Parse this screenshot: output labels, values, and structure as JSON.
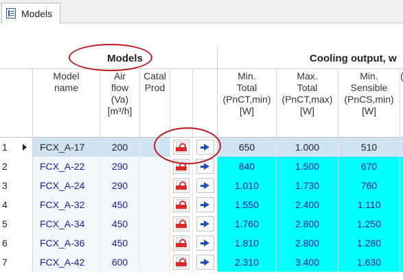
{
  "tab": {
    "title": "Models",
    "icon": "list-window-icon"
  },
  "groups": {
    "models": "Models",
    "cooling": "Cooling output, w"
  },
  "columns": [
    {
      "key": "model_name",
      "label": "Model\nname"
    },
    {
      "key": "air_flow",
      "label": "Air\nflow\n(Va)\n[m³/h]"
    },
    {
      "key": "catal_prod",
      "label": "Catal\nProd"
    },
    {
      "key": "pdf",
      "label": ""
    },
    {
      "key": "go",
      "label": ""
    },
    {
      "key": "min_total",
      "label": "Min.\nTotal\n(PnCT,min)\n[W]"
    },
    {
      "key": "max_total",
      "label": "Max.\nTotal\n(PnCT,max)\n[W]"
    },
    {
      "key": "min_sensible",
      "label": "Min.\nSensible\n(PnCS,min)\n[W]"
    },
    {
      "key": "more",
      "label": "("
    }
  ],
  "rows": [
    {
      "idx": "1",
      "name": "FCX_A-17",
      "air": "200",
      "v1": "650",
      "v2": "1.000",
      "v3": "510",
      "selected": true
    },
    {
      "idx": "2",
      "name": "FCX_A-22",
      "air": "290",
      "v1": "840",
      "v2": "1.500",
      "v3": "670"
    },
    {
      "idx": "3",
      "name": "FCX_A-24",
      "air": "290",
      "v1": "1.010",
      "v2": "1.730",
      "v3": "760"
    },
    {
      "idx": "4",
      "name": "FCX_A-32",
      "air": "450",
      "v1": "1.550",
      "v2": "2.400",
      "v3": "1.110"
    },
    {
      "idx": "5",
      "name": "FCX_A-34",
      "air": "450",
      "v1": "1.760",
      "v2": "2.800",
      "v3": "1.250"
    },
    {
      "idx": "6",
      "name": "FCX_A-36",
      "air": "450",
      "v1": "1.810",
      "v2": "2.800",
      "v3": "1.280"
    },
    {
      "idx": "7",
      "name": "FCX_A-42",
      "air": "600",
      "v1": "2.310",
      "v2": "3.400",
      "v3": "1.630"
    }
  ],
  "colors": {
    "cyan_cell": "#00ffff",
    "selected_row": "#cfe3f3",
    "value_text": "#1a1aa8",
    "annotation": "#c0161e"
  }
}
